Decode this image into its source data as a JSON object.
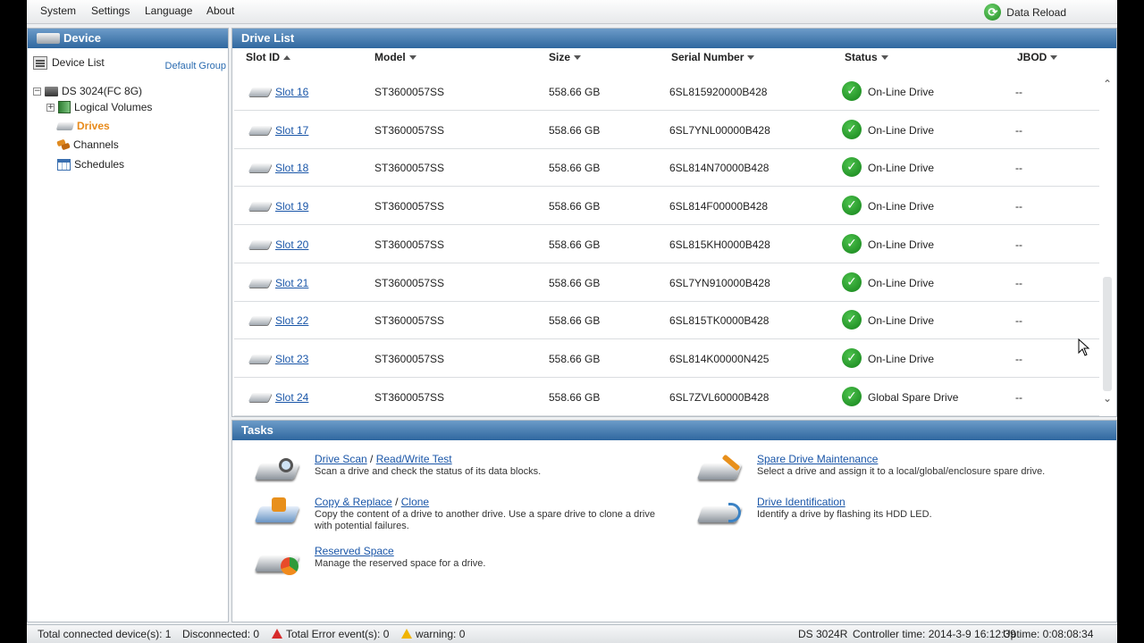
{
  "menu": {
    "items": [
      "System",
      "Settings",
      "Language",
      "About"
    ],
    "reload_label": "Data Reload"
  },
  "left": {
    "header": "Device",
    "device_list_label": "Device List",
    "default_group": "Default Group",
    "tree": {
      "device": "DS 3024(FC 8G)",
      "logical_volumes": "Logical Volumes",
      "drives": "Drives",
      "channels": "Channels",
      "schedules": "Schedules"
    }
  },
  "drive_list": {
    "header": "Drive List",
    "columns": {
      "slot": "Slot ID",
      "model": "Model",
      "size": "Size",
      "serial": "Serial Number",
      "status": "Status",
      "jbod": "JBOD"
    },
    "rows": [
      {
        "slot": "Slot 16",
        "model": "ST3600057SS",
        "size": "558.66 GB",
        "serial": "6SL815920000B428",
        "status": "On-Line Drive",
        "jbod": "--"
      },
      {
        "slot": "Slot 17",
        "model": "ST3600057SS",
        "size": "558.66 GB",
        "serial": "6SL7YNL00000B428",
        "status": "On-Line Drive",
        "jbod": "--"
      },
      {
        "slot": "Slot 18",
        "model": "ST3600057SS",
        "size": "558.66 GB",
        "serial": "6SL814N70000B428",
        "status": "On-Line Drive",
        "jbod": "--"
      },
      {
        "slot": "Slot 19",
        "model": "ST3600057SS",
        "size": "558.66 GB",
        "serial": "6SL814F00000B428",
        "status": "On-Line Drive",
        "jbod": "--"
      },
      {
        "slot": "Slot 20",
        "model": "ST3600057SS",
        "size": "558.66 GB",
        "serial": "6SL815KH0000B428",
        "status": "On-Line Drive",
        "jbod": "--"
      },
      {
        "slot": "Slot 21",
        "model": "ST3600057SS",
        "size": "558.66 GB",
        "serial": "6SL7YN910000B428",
        "status": "On-Line Drive",
        "jbod": "--"
      },
      {
        "slot": "Slot 22",
        "model": "ST3600057SS",
        "size": "558.66 GB",
        "serial": "6SL815TK0000B428",
        "status": "On-Line Drive",
        "jbod": "--"
      },
      {
        "slot": "Slot 23",
        "model": "ST3600057SS",
        "size": "558.66 GB",
        "serial": "6SL814K00000N425",
        "status": "On-Line Drive",
        "jbod": "--"
      },
      {
        "slot": "Slot 24",
        "model": "ST3600057SS",
        "size": "558.66 GB",
        "serial": "6SL7ZVL60000B428",
        "status": "Global Spare Drive",
        "jbod": "--"
      }
    ]
  },
  "tasks": {
    "header": "Tasks",
    "drive_scan": {
      "link1": "Drive Scan",
      "sep": "/",
      "link2": "Read/Write Test",
      "desc": "Scan a drive and check the status of its data blocks."
    },
    "copy_replace": {
      "link1": "Copy & Replace",
      "sep": "/",
      "link2": "Clone",
      "desc1": "Copy the content of a drive to another drive. Use a spare drive to clone a drive",
      "desc2": "with potential failures."
    },
    "reserved_space": {
      "link1": "Reserved Space",
      "desc": "Manage the reserved space for a drive."
    },
    "spare_maint": {
      "link1": "Spare Drive Maintenance",
      "desc": "Select a drive and assign it to a local/global/enclosure spare drive."
    },
    "drive_ident": {
      "link1": "Drive Identification",
      "desc": "Identify a drive by flashing its HDD LED."
    }
  },
  "status_bar": {
    "connected": "Total connected device(s): 1",
    "disconnected": "Disconnected: 0",
    "errors": "Total Error event(s): 0",
    "warning": "warning: 0",
    "model": "DS 3024R",
    "controller_time": "Controller time: 2014-3-9 16:12:39",
    "uptime": "Uptime: 0:08:08:34"
  }
}
